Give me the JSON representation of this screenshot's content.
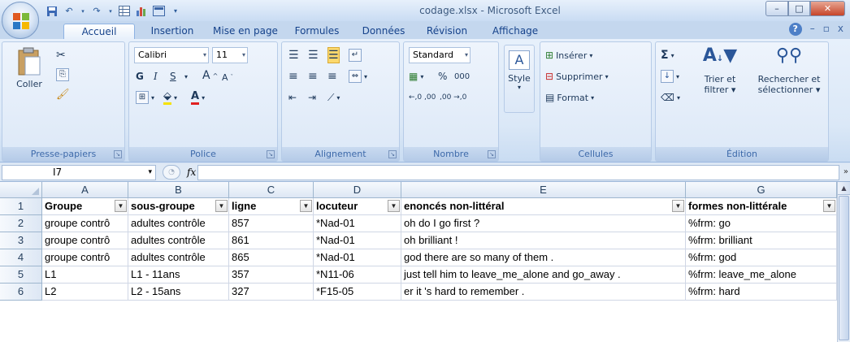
{
  "window": {
    "title": "codage.xlsx - Microsoft Excel",
    "min": "–",
    "max": "□",
    "close": "✕"
  },
  "qat": [
    "save-icon",
    "undo-icon",
    "redo-icon",
    "grid-icon",
    "chart-icon",
    "table-icon",
    "customize-icon"
  ],
  "tabs": [
    "Accueil",
    "Insertion",
    "Mise en page",
    "Formules",
    "Données",
    "Révision",
    "Affichage"
  ],
  "help": {
    "icon": "?",
    "minimize": "–",
    "restore": "▫",
    "close": "x"
  },
  "ribbon": {
    "clipboard": {
      "paste": "Coller",
      "label": "Presse-papiers"
    },
    "font": {
      "family": "Calibri",
      "size": "11",
      "bold": "G",
      "italic": "I",
      "underline": "S",
      "grow": "A",
      "shrink": "A",
      "label": "Police"
    },
    "alignment": {
      "label": "Alignement"
    },
    "number": {
      "format": "Standard",
      "percent": "%",
      "thousands": "000",
      "inc_dec": "←,0 ,00",
      "dec_dec": ",00 →,0",
      "label": "Nombre"
    },
    "style": {
      "button": "Style"
    },
    "cells": {
      "insert": "Insérer",
      "delete": "Supprimer",
      "format": "Format",
      "label": "Cellules"
    },
    "editing": {
      "sum": "Σ",
      "sort_line1": "Trier et",
      "sort_line2": "filtrer",
      "find_line1": "Rechercher et",
      "find_line2": "sélectionner",
      "label": "Édition"
    }
  },
  "formula_bar": {
    "name_box": "I7",
    "fx": "fx",
    "value": ""
  },
  "columns": [
    "A",
    "B",
    "C",
    "D",
    "E",
    "G"
  ],
  "rows": [
    {
      "num": "1",
      "cells": [
        "Groupe",
        "sous-groupe",
        "ligne",
        "locuteur",
        "enoncés non-littéral",
        "formes non-littérale"
      ]
    },
    {
      "num": "2",
      "cells": [
        "groupe contrô",
        "adultes contrôle",
        "857",
        "*Nad-01",
        "oh do I go first ?",
        "%frm: go"
      ]
    },
    {
      "num": "3",
      "cells": [
        "groupe contrô",
        "adultes contrôle",
        "861",
        "*Nad-01",
        "oh brilliant !",
        "%frm: brilliant"
      ]
    },
    {
      "num": "4",
      "cells": [
        "groupe contrô",
        "adultes contrôle",
        "865",
        "*Nad-01",
        "god there are so many of them .",
        "%frm: god"
      ]
    },
    {
      "num": "5",
      "cells": [
        "L1",
        "L1 - 11ans",
        "357",
        "*N11-06",
        "just tell him to leave_me_alone and go_away .",
        "%frm: leave_me_alone"
      ]
    },
    {
      "num": "6",
      "cells": [
        "L2",
        "L2 - 15ans",
        "327",
        "*F15-05",
        "er it 's hard to remember .",
        "%frm: hard"
      ]
    }
  ]
}
